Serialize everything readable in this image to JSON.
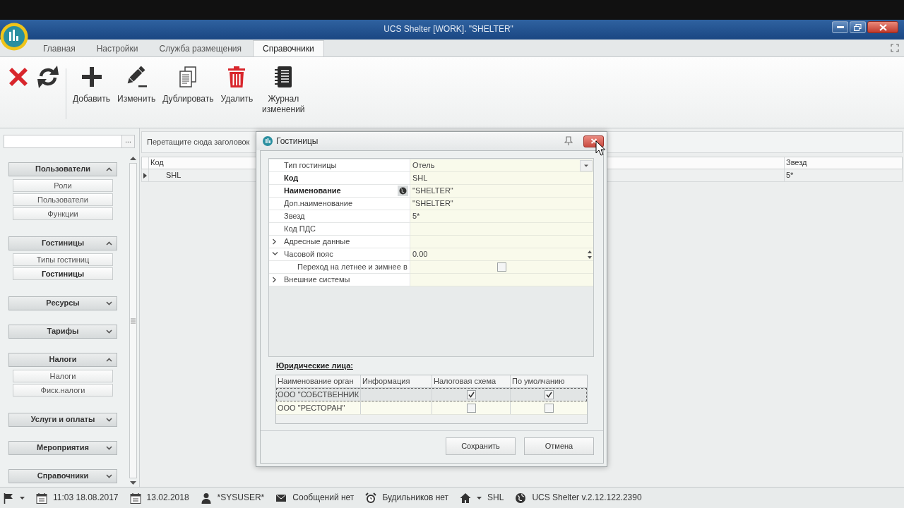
{
  "window": {
    "title": "UCS Shelter [WORK]. \"SHELTER\""
  },
  "ribbon_tabs": [
    {
      "label": "Главная",
      "selected": false
    },
    {
      "label": "Настройки",
      "selected": false
    },
    {
      "label": "Служба размещения",
      "selected": false
    },
    {
      "label": "Справочники",
      "selected": true
    }
  ],
  "ribbon_buttons": [
    {
      "kind": "cancel"
    },
    {
      "kind": "refresh"
    },
    {
      "kind": "add",
      "label": "Добавить"
    },
    {
      "kind": "edit",
      "label": "Изменить"
    },
    {
      "kind": "duplicate",
      "label": "Дублировать"
    },
    {
      "kind": "delete",
      "label": "Удалить"
    },
    {
      "kind": "log",
      "label": "Журнал изменений"
    }
  ],
  "sidebar": {
    "browse_button": "...",
    "groups": [
      {
        "label": "Пользователи",
        "expanded": true,
        "items": [
          {
            "label": "Роли",
            "selected": false
          },
          {
            "label": "Пользователи",
            "selected": false
          },
          {
            "label": "Функции",
            "selected": false
          }
        ]
      },
      {
        "label": "Гостиницы",
        "expanded": true,
        "items": [
          {
            "label": "Типы гостиниц",
            "selected": false
          },
          {
            "label": "Гостиницы",
            "selected": true
          }
        ]
      },
      {
        "label": "Ресурсы",
        "expanded": false
      },
      {
        "label": "Тарифы",
        "expanded": false
      },
      {
        "label": "Налоги",
        "expanded": true,
        "items": [
          {
            "label": "Налоги",
            "selected": false
          },
          {
            "label": "Фиск.налоги",
            "selected": false
          }
        ]
      },
      {
        "label": "Услуги и оплаты",
        "expanded": false
      },
      {
        "label": "Мероприятия",
        "expanded": false
      },
      {
        "label": "Справочники",
        "expanded": false
      }
    ]
  },
  "grid": {
    "group_panel_hint": "Перетащите сюда заголовок",
    "columns": [
      "Код",
      "Звезд"
    ],
    "rows": [
      {
        "selected": true,
        "cells": [
          "SHL",
          "5*"
        ]
      }
    ]
  },
  "dialog": {
    "title": "Гостиницы",
    "properties": [
      {
        "label": "Тип гостиницы",
        "bold": false,
        "kind": "dropdown",
        "value": "Отель"
      },
      {
        "label": "Код",
        "bold": true,
        "kind": "text",
        "value": "SHL"
      },
      {
        "label": "Наименование",
        "bold": true,
        "kind": "localized",
        "value": "\"SHELTER\""
      },
      {
        "label": "Доп.наименование",
        "bold": false,
        "kind": "text",
        "value": "\"SHELTER\""
      },
      {
        "label": "Звезд",
        "bold": false,
        "kind": "text",
        "value": "5*"
      },
      {
        "label": "Код ПДС",
        "bold": false,
        "kind": "text"
      },
      {
        "label": "Адресные данные",
        "bold": false,
        "kind": "text",
        "expanded": false
      },
      {
        "label": "Часовой пояс",
        "bold": false,
        "kind": "spin",
        "value": "0.00",
        "expanded": true,
        "children": [
          {
            "label": "Переход на летнее и зимнее в",
            "bold": false,
            "kind": "checkbox",
            "checked": false
          }
        ]
      },
      {
        "label": "Внешние системы",
        "bold": false,
        "kind": "text",
        "expanded": false
      }
    ],
    "legal_entities": {
      "title": "Юридические лица:",
      "columns": [
        "Наименование орган",
        "Информация",
        "Налоговая схема",
        "По умолчанию"
      ],
      "rows": [
        {
          "name": "ООО \"СОБСТВЕННИК",
          "tax_scheme": true,
          "default": true,
          "selected": true
        },
        {
          "name": "ООО \"РЕСТОРАН\"",
          "tax_scheme": false,
          "default": false,
          "selected": false
        }
      ]
    },
    "buttons": [
      "Сохранить",
      "Отмена"
    ]
  },
  "status_bar": [
    {
      "kind": "flag",
      "dropdown": true
    },
    {
      "kind": "datetime",
      "dropdown": false,
      "text": "11:03 18.08.2017"
    },
    {
      "kind": "date",
      "dropdown": false,
      "text": "13.02.2018"
    },
    {
      "kind": "user",
      "dropdown": false,
      "text": "*SYSUSER*"
    },
    {
      "kind": "messages",
      "dropdown": false,
      "text": "Сообщений нет"
    },
    {
      "kind": "alarms",
      "dropdown": false,
      "text": "Будильников нет"
    },
    {
      "kind": "hotel",
      "dropdown": true,
      "text": "SHL"
    },
    {
      "kind": "version",
      "dropdown": false,
      "text": "UCS Shelter v.2.12.122.2390"
    }
  ]
}
